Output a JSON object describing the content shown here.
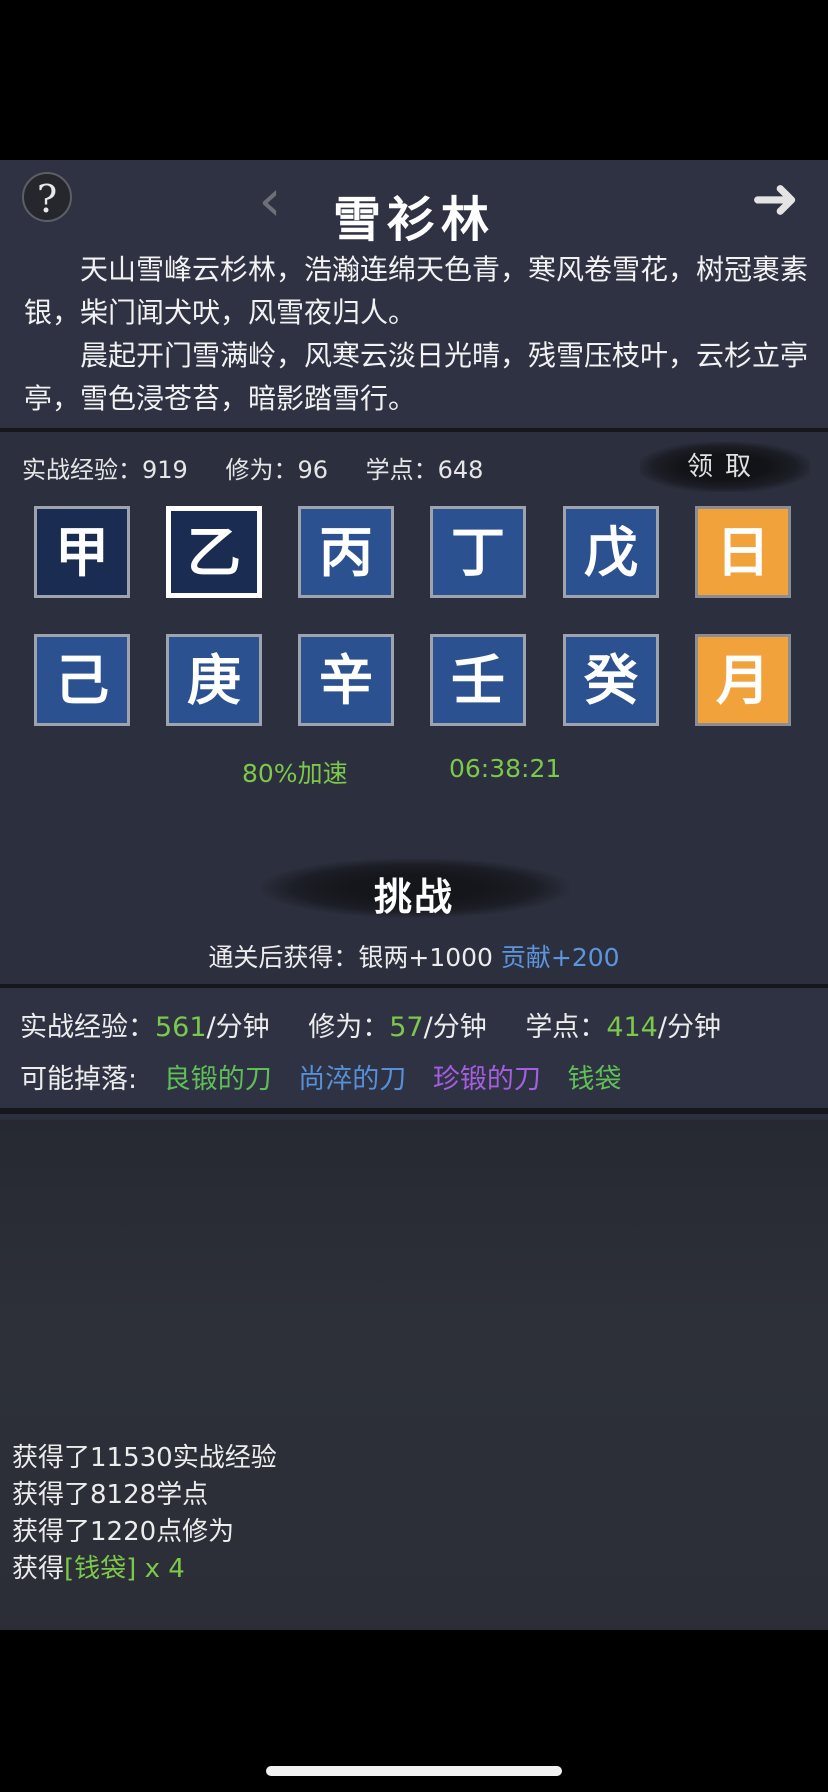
{
  "header": {
    "help_icon": "?",
    "back_icon": "‹",
    "forward_icon": "➜",
    "title": "雪衫林"
  },
  "poem": {
    "para1": "天山雪峰云杉林，浩瀚连绵天色青，寒风卷雪花，树冠裹素银，柴门闻犬吠，风雪夜归人。",
    "para2": "晨起开门雪满岭，风寒云淡日光晴，残雪压枝叶，云杉立亭亭，雪色浸苍苔，暗影踏雪行。"
  },
  "stats": {
    "exp": "实战经验：919",
    "cultivation": "修为：96",
    "points": "学点：648",
    "claim_label": "领取"
  },
  "tiles": {
    "row1": [
      "甲",
      "乙",
      "丙",
      "丁",
      "戊",
      "日"
    ],
    "row2": [
      "己",
      "庚",
      "辛",
      "壬",
      "癸",
      "月"
    ],
    "selected": "乙"
  },
  "boost": {
    "speed": "80%加速",
    "timer": "06:38:21"
  },
  "challenge": {
    "title": "挑战",
    "reward_prefix": "通关后获得：银两+1000",
    "reward_highlight": "贡献+200"
  },
  "rates": {
    "exp_label": "实战经验：",
    "exp_value": "561",
    "cult_label": "修为：",
    "cult_value": "57",
    "points_label": "学点：",
    "points_value": "414",
    "unit": "/分钟"
  },
  "drops": {
    "label": "可能掉落:",
    "items": [
      "良锻的刀",
      "尚淬的刀",
      "珍锻的刀",
      "钱袋"
    ]
  },
  "log": {
    "line1": "获得了11530实战经验",
    "line2": "获得了8128学点",
    "line3": "获得了1220点修为",
    "line4_prefix": "获得",
    "line4_item": "[钱袋]",
    "line4_count": " x 4"
  },
  "colors": {
    "tile_blue": "#2c5190",
    "tile_orange": "#f2a23a",
    "green": "#7cc84a",
    "blue": "#5590d8",
    "purple": "#a55ee0"
  }
}
